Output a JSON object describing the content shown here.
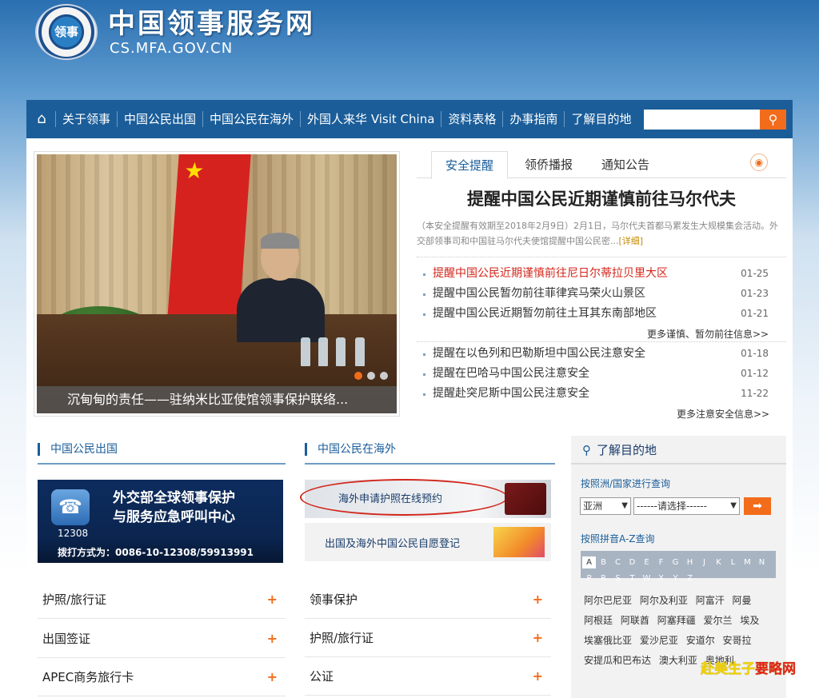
{
  "site": {
    "logo_text": "领事",
    "title": "中国领事服务网",
    "domain": "CS.MFA.GOV.CN"
  },
  "nav": {
    "items": [
      "关于领事",
      "中国公民出国",
      "中国公民在海外",
      "外国人来华 Visit China",
      "资料表格",
      "办事指南",
      "了解目的地"
    ],
    "search_placeholder": "",
    "home_icon": "home-icon",
    "search_icon": "search-icon"
  },
  "slideshow": {
    "caption": "沉甸甸的责任——驻纳米比亚使馆领事保护联络...",
    "dots": 3,
    "active_dot": 1
  },
  "notices": {
    "tabs": [
      "安全提醒",
      "领侨播报",
      "通知公告"
    ],
    "headline": "提醒中国公民近期谨慎前往马尔代夫",
    "summary": "（本安全提醒有效期至2018年2月9日）2月1日，马尔代夫首都马累发生大规模集会活动。外交部领事司和中国驻马尔代夫使馆提醒中国公民密...",
    "summary_more": "[详细]",
    "group1": [
      {
        "title": "提醒中国公民近期谨慎前往尼日尔蒂拉贝里大区",
        "date": "01-25",
        "highlight": true
      },
      {
        "title": "提醒中国公民暂勿前往菲律宾马荣火山景区",
        "date": "01-23",
        "highlight": false
      },
      {
        "title": "提醒中国公民近期暂勿前往土耳其东南部地区",
        "date": "01-21",
        "highlight": false
      }
    ],
    "more1": "更多谨慎、暂勿前往信息>>",
    "group2": [
      {
        "title": "提醒在以色列和巴勒斯坦中国公民注意安全",
        "date": "01-18"
      },
      {
        "title": "提醒在巴哈马中国公民注意安全",
        "date": "01-12"
      },
      {
        "title": "提醒赴突尼斯中国公民注意安全",
        "date": "11-22"
      }
    ],
    "more2": "更多注意安全信息>>"
  },
  "outbound": {
    "title": "中国公民出国",
    "banner": {
      "line1": "外交部全球领事保护",
      "line2": "与服务应急呼叫中心",
      "number": "12308",
      "tel": "拨打方式为：0086-10-12308/59913991"
    },
    "rows": [
      "护照/旅行证",
      "出国签证",
      "APEC商务旅行卡"
    ]
  },
  "overseas": {
    "title": "中国公民在海外",
    "banner1": "海外申请护照在线预约",
    "banner2": "出国及海外中国公民自愿登记",
    "rows": [
      "领事保护",
      "护照/旅行证",
      "公证"
    ]
  },
  "destination": {
    "title": "了解目的地",
    "by_country_label": "按照洲/国家进行查询",
    "continent": "亚洲",
    "country_placeholder": "------请选择------",
    "go_icon": "arrow-right-icon",
    "by_pinyin_label": "按照拼音A-Z查询",
    "letters": [
      "A",
      "B",
      "C",
      "D",
      "E",
      "F",
      "G",
      "H",
      "J",
      "K",
      "L",
      "M",
      "N",
      "P",
      "R",
      "S",
      "T",
      "W",
      "X",
      "Y",
      "Z"
    ],
    "current_letter": "A",
    "countries": [
      "阿尔巴尼亚",
      "阿尔及利亚",
      "阿富汗",
      "阿曼",
      "阿根廷",
      "阿联酋",
      "阿塞拜疆",
      "爱尔兰",
      "埃及",
      "埃塞俄比亚",
      "爱沙尼亚",
      "安道尔",
      "安哥拉",
      "安提瓜和巴布达",
      "澳大利亚",
      "奥地利"
    ]
  },
  "watermark": {
    "part1": "赴美生子",
    "part2": "要略网"
  },
  "colors": {
    "nav_bg": "#1a5d99",
    "accent": "#f26c1b",
    "alert_red": "#d3261c"
  }
}
